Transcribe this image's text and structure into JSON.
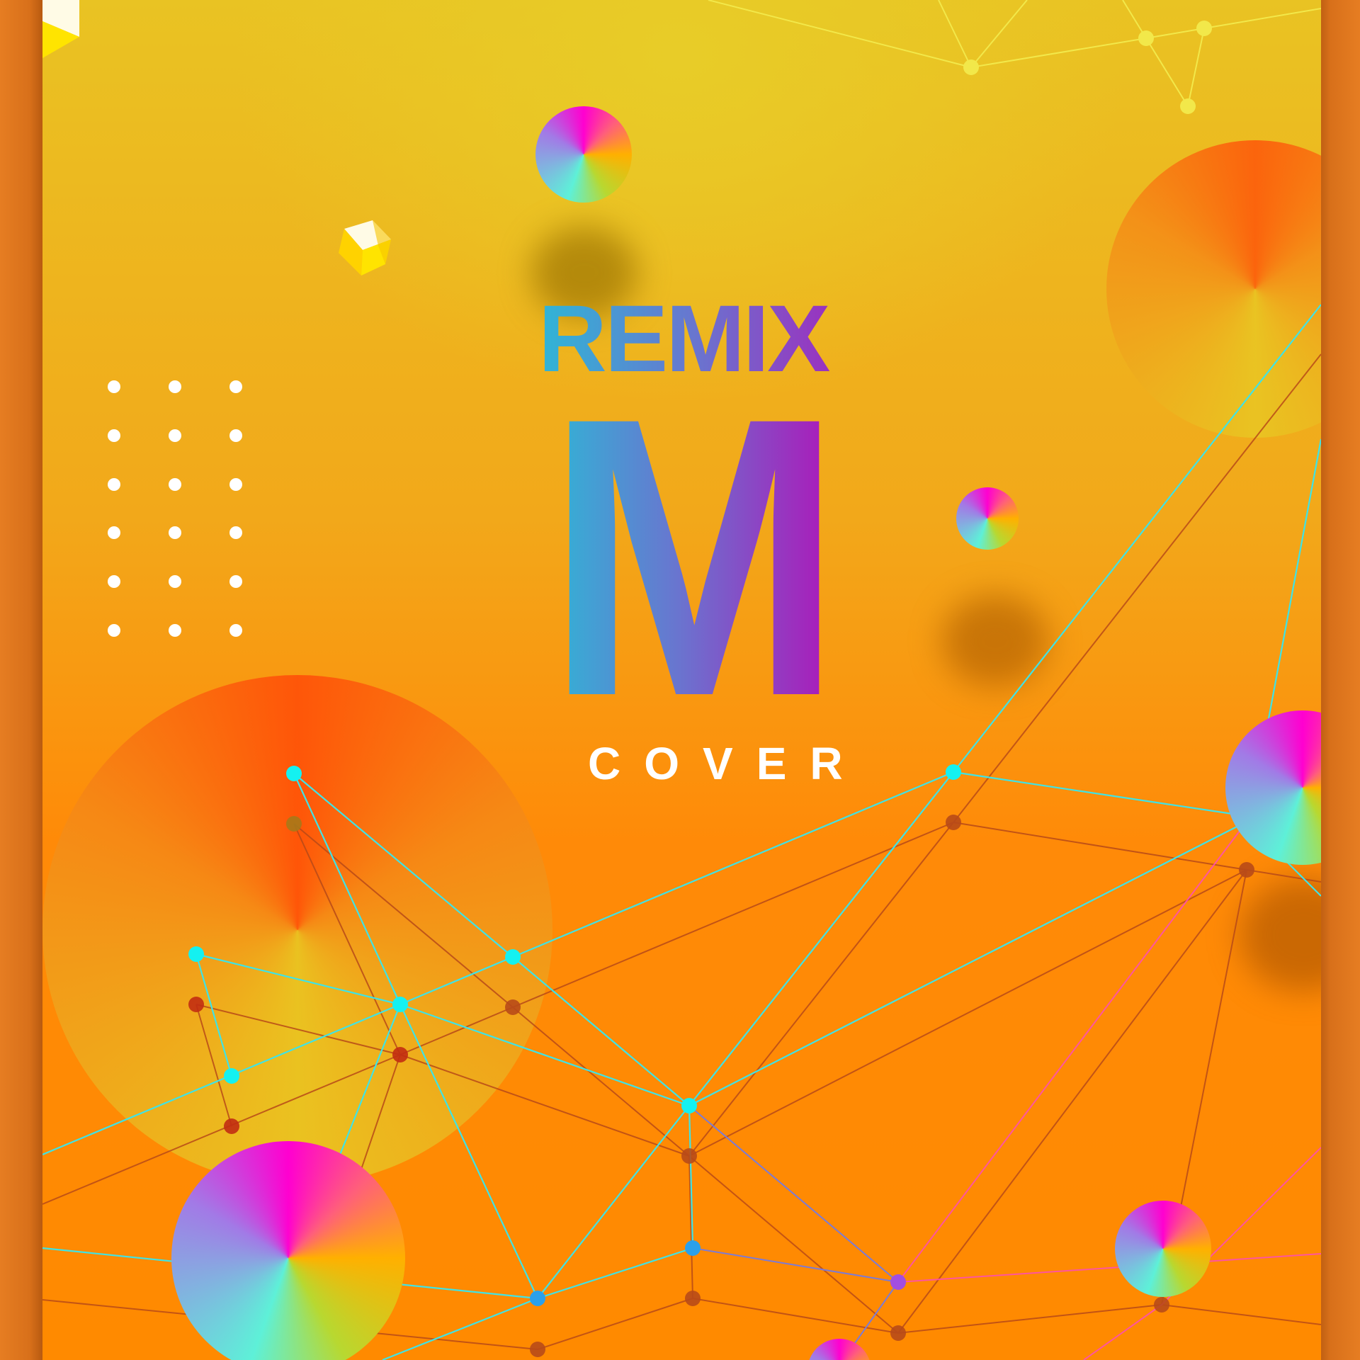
{
  "cover": {
    "title_top": "REMIX",
    "title_letter": "M",
    "subtitle": "COVER"
  },
  "colors": {
    "background_top": "#e9c323",
    "background_bottom": "#ff8a00",
    "frame": "#d9741a",
    "network_cyan": "#3fe3e6",
    "network_dark": "#b5401a",
    "title_gradient_start": "#2fb6d6",
    "title_gradient_end": "#b112b7"
  }
}
